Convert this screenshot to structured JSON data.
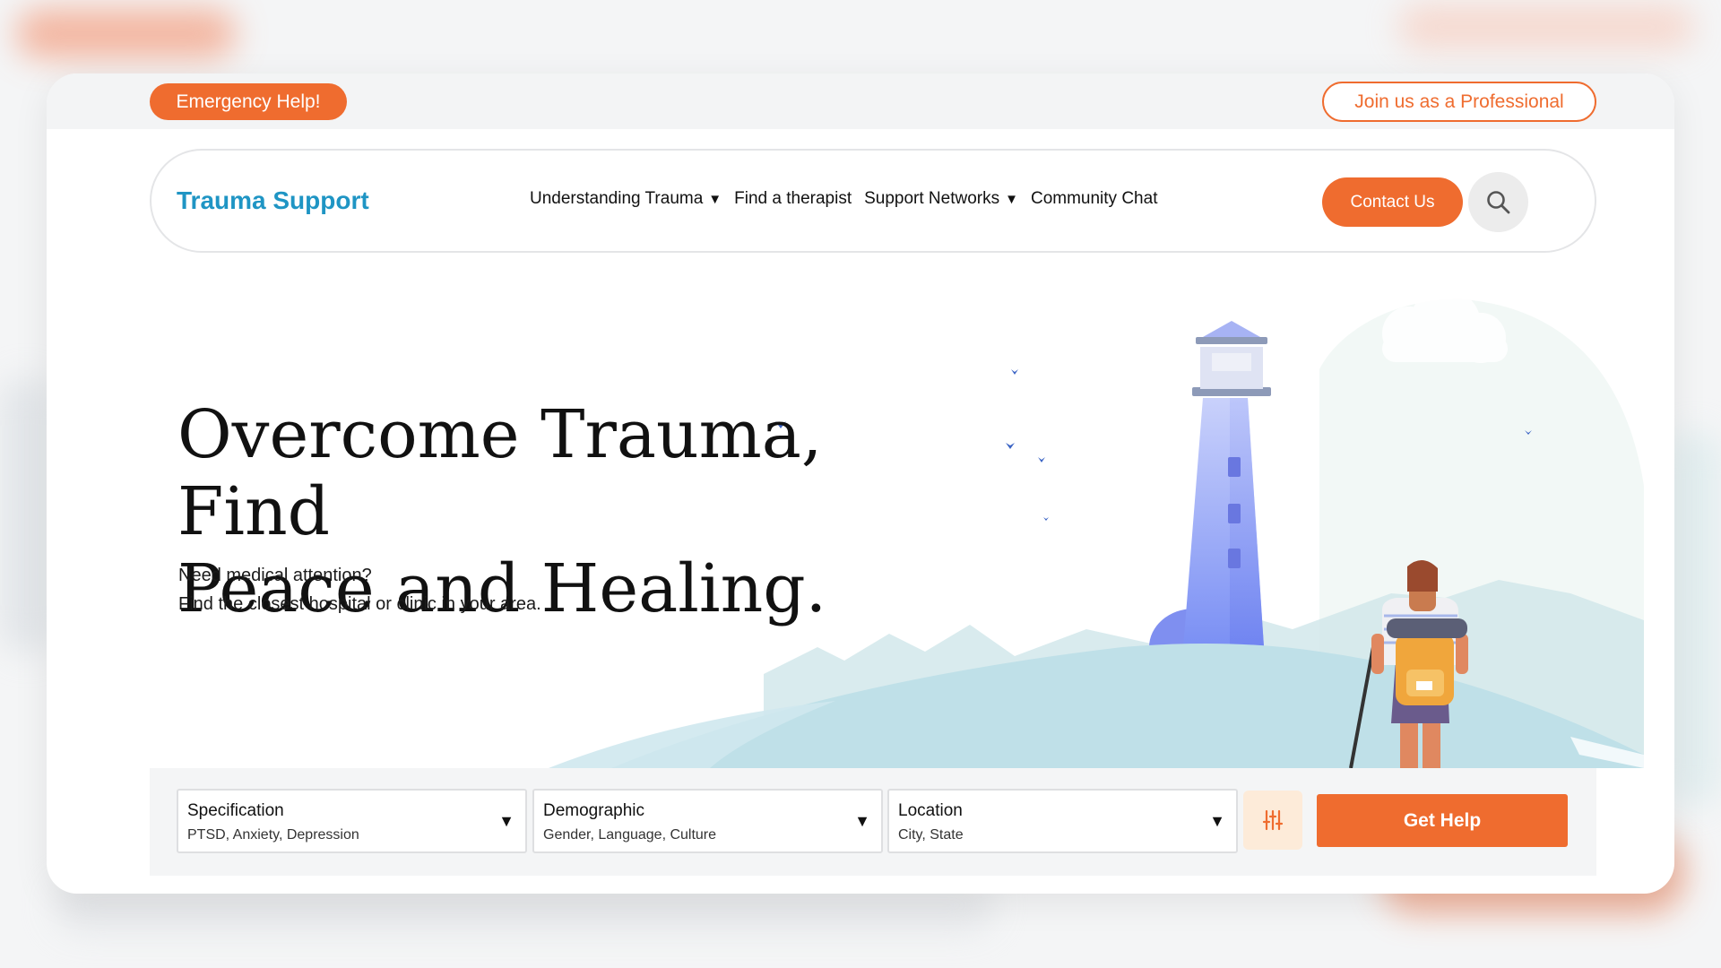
{
  "topbar": {
    "emergency_label": "Emergency Help!",
    "join_label": "Join us as a Professional"
  },
  "navbar": {
    "brand": "Trauma Support",
    "links": [
      {
        "label": "Understanding Trauma",
        "has_dropdown": true
      },
      {
        "label": "Find a therapist",
        "has_dropdown": false
      },
      {
        "label": "Support Networks",
        "has_dropdown": true
      },
      {
        "label": "Community Chat",
        "has_dropdown": false
      }
    ],
    "dropdown_glyph": "▼",
    "contact_label": "Contact Us",
    "search_icon": "search-icon"
  },
  "hero": {
    "title_line1": "Overcome Trauma, Find",
    "title_line2": "Peace and Healing.",
    "subtitle_line1": "Need medical attention?",
    "subtitle_line2": "Find the closest hospital or clinic in your area."
  },
  "search": {
    "fields": [
      {
        "label": "Specification",
        "hint": "PTSD, Anxiety, Depression"
      },
      {
        "label": "Demographic",
        "hint": "Gender, Language, Culture"
      },
      {
        "label": "Location",
        "hint": "City, State"
      }
    ],
    "caret_glyph": "▼",
    "filter_icon": "sliders-icon",
    "submit_label": "Get Help"
  },
  "colors": {
    "accent": "#ef6c2f",
    "brand": "#1f95c4",
    "lighthouse": "#7c8ff2",
    "hills": "#bfe0e8"
  }
}
